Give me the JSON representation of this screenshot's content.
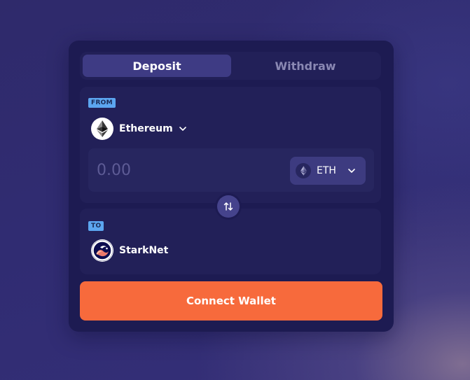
{
  "tabs": [
    {
      "label": "Deposit",
      "active": true
    },
    {
      "label": "Withdraw",
      "active": false
    }
  ],
  "from": {
    "badge": "FROM",
    "network": "Ethereum",
    "network_icon": "ethereum-icon",
    "amount_placeholder": "0.00",
    "amount_value": "",
    "token": "ETH",
    "token_icon": "eth-token-icon"
  },
  "to": {
    "badge": "TO",
    "network": "StarkNet",
    "network_icon": "starknet-icon"
  },
  "swap_icon": "swap-arrows-icon",
  "connect_label": "Connect Wallet",
  "colors": {
    "card": "#1d1b52",
    "section": "#222058",
    "active_tab": "#3e3b84",
    "badge": "#5ca6f0",
    "accent": "#f76a3c"
  }
}
